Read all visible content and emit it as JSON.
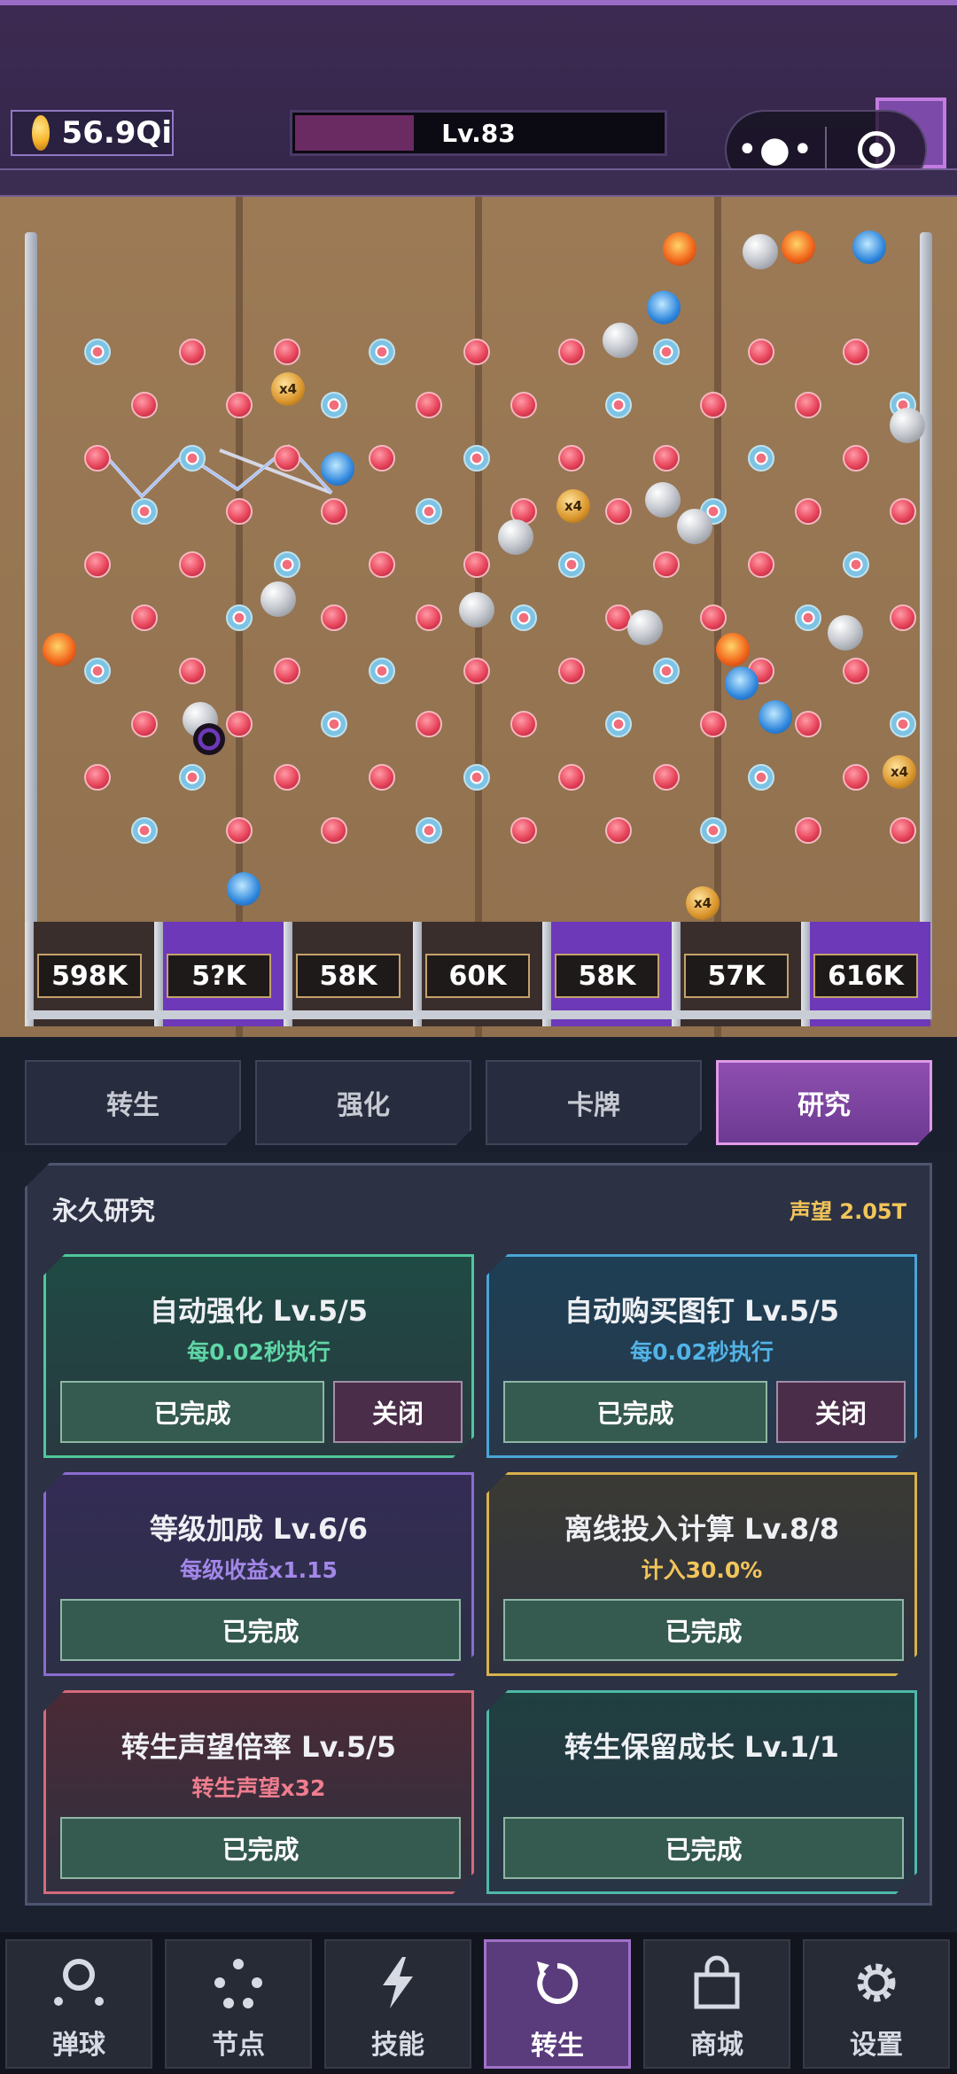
{
  "topbar": {
    "coin_value": "56.9Qi",
    "level_label": "Lv.83",
    "level_progress": 0.32
  },
  "board": {
    "bins": [
      {
        "label": "598K",
        "active": false
      },
      {
        "label": "5?K",
        "active": true
      },
      {
        "label": "58K",
        "active": false
      },
      {
        "label": "60K",
        "active": false
      },
      {
        "label": "58K",
        "active": true
      },
      {
        "label": "57K",
        "active": false
      },
      {
        "label": "616K",
        "active": true
      }
    ],
    "multiplier_badge": "x4"
  },
  "tabs": [
    {
      "label": "转生",
      "active": false
    },
    {
      "label": "强化",
      "active": false
    },
    {
      "label": "卡牌",
      "active": false
    },
    {
      "label": "研究",
      "active": true
    }
  ],
  "research": {
    "title": "永久研究",
    "prestige": "声望 2.05T",
    "cards": [
      {
        "title": "自动强化 Lv.5/5",
        "subtitle": "每0.02秒执行",
        "done_label": "已完成",
        "toggle_label": "关闭",
        "theme": "green"
      },
      {
        "title": "自动购买图钉 Lv.5/5",
        "subtitle": "每0.02秒执行",
        "done_label": "已完成",
        "toggle_label": "关闭",
        "theme": "blue"
      },
      {
        "title": "等级加成 Lv.6/6",
        "subtitle": "每级收益x1.15",
        "done_label": "已完成",
        "theme": "purple"
      },
      {
        "title": "离线投入计算 Lv.8/8",
        "subtitle": "计入30.0%",
        "done_label": "已完成",
        "theme": "gold"
      },
      {
        "title": "转生声望倍率 Lv.5/5",
        "subtitle": "转生声望x32",
        "done_label": "已完成",
        "theme": "red"
      },
      {
        "title": "转生保留成长 Lv.1/1",
        "subtitle": "",
        "done_label": "已完成",
        "theme": "teal"
      }
    ]
  },
  "nav": [
    {
      "label": "弹球",
      "icon": "pinball-icon",
      "active": false
    },
    {
      "label": "节点",
      "icon": "nodes-icon",
      "active": false
    },
    {
      "label": "技能",
      "icon": "lightning-icon",
      "active": false
    },
    {
      "label": "转生",
      "icon": "rebirth-icon",
      "active": true
    },
    {
      "label": "商城",
      "icon": "shop-bag-icon",
      "active": false
    },
    {
      "label": "设置",
      "icon": "gear-icon",
      "active": false
    }
  ]
}
